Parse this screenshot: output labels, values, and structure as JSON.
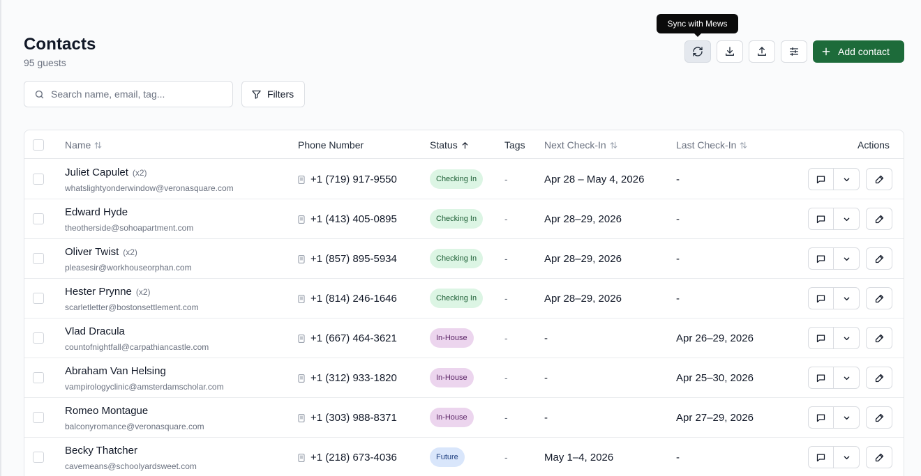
{
  "header": {
    "title": "Contacts",
    "subtitle": "95 guests",
    "tooltip": "Sync with Mews",
    "add_label": "Add contact",
    "accent": "#1d6b3a"
  },
  "toolbar": {
    "buttons": [
      {
        "icon": "sync-icon"
      },
      {
        "icon": "download-icon"
      },
      {
        "icon": "upload-icon"
      },
      {
        "icon": "sliders-icon"
      }
    ]
  },
  "search": {
    "placeholder": "Search name, email, tag...",
    "value": ""
  },
  "filters": {
    "label": "Filters"
  },
  "table": {
    "columns": {
      "name": "Name",
      "phone": "Phone Number",
      "status": "Status",
      "tags": "Tags",
      "next": "Next Check-In",
      "last": "Last Check-In",
      "actions": "Actions"
    },
    "rows": [
      {
        "name": "Juliet Capulet",
        "multi": "(x2)",
        "email": "whatslightyonderwindow@veronasquare.com",
        "phone": "+1 (719) 917-9550",
        "status": "Checking In",
        "tags": "-",
        "next": "Apr 28 – May 4, 2026",
        "last": "-"
      },
      {
        "name": "Edward Hyde",
        "multi": "",
        "email": "theotherside@sohoapartment.com",
        "phone": "+1 (413) 405-0895",
        "status": "Checking In",
        "tags": "-",
        "next": "Apr 28–29, 2026",
        "last": "-"
      },
      {
        "name": "Oliver Twist",
        "multi": "(x2)",
        "email": "pleasesir@workhouseorphan.com",
        "phone": "+1 (857) 895-5934",
        "status": "Checking In",
        "tags": "-",
        "next": "Apr 28–29, 2026",
        "last": "-"
      },
      {
        "name": "Hester Prynne",
        "multi": "(x2)",
        "email": "scarletletter@bostonsettlement.com",
        "phone": "+1 (814) 246-1646",
        "status": "Checking In",
        "tags": "-",
        "next": "Apr 28–29, 2026",
        "last": "-"
      },
      {
        "name": "Vlad Dracula",
        "multi": "",
        "email": "countofnightfall@carpathiancastle.com",
        "phone": "+1 (667) 464-3621",
        "status": "In-House",
        "tags": "-",
        "next": "-",
        "last": "Apr 26–29, 2026"
      },
      {
        "name": "Abraham Van Helsing",
        "multi": "",
        "email": "vampirologyclinic@amsterdamscholar.com",
        "phone": "+1 (312) 933-1820",
        "status": "In-House",
        "tags": "-",
        "next": "-",
        "last": "Apr 25–30, 2026"
      },
      {
        "name": "Romeo Montague",
        "multi": "",
        "email": "balconyromance@veronasquare.com",
        "phone": "+1 (303) 988-8371",
        "status": "In-House",
        "tags": "-",
        "next": "-",
        "last": "Apr 27–29, 2026"
      },
      {
        "name": "Becky Thatcher",
        "multi": "",
        "email": "cavemeans@schoolyardsweet.com",
        "phone": "+1 (218) 673-4036",
        "status": "Future",
        "tags": "-",
        "next": "May 1–4, 2026",
        "last": "-"
      }
    ]
  },
  "status_colors": {
    "Checking In": {
      "bg": "#dcf5e4",
      "fg": "#1a5c33"
    },
    "In-House": {
      "bg": "#ecd5ee",
      "fg": "#5b2466"
    },
    "Future": {
      "bg": "#d9e6fb",
      "fg": "#1e3f80"
    }
  }
}
